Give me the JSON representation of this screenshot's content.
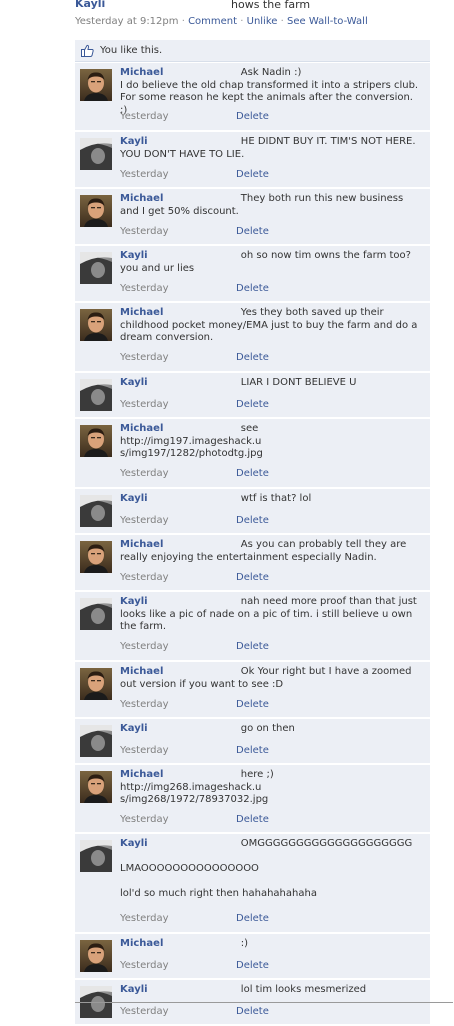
{
  "post": {
    "author": "Kayli",
    "text": "hows the farm",
    "timestamp": "Yesterday at 9:12pm",
    "comment_link": "Comment",
    "unlike_link": "Unlike",
    "wall_link": "See Wall-to-Wall"
  },
  "likes": {
    "text": "You like this.",
    "icon": "thumbs-up-icon"
  },
  "comments": [
    {
      "author": "Michael",
      "text": "Ask Nadin :)\nI do believe the old chap transformed it into a stripers club. For some reason he kept the animals after the conversion. ;)",
      "time": "Yesterday",
      "delete": "Delete"
    },
    {
      "author": "Kayli",
      "text": "HE DIDNT BUY IT. TIM'S NOT HERE. YOU DON'T HAVE TO LIE.",
      "time": "Yesterday",
      "delete": "Delete"
    },
    {
      "author": "Michael",
      "text": "They both run this new business and I get 50% discount.",
      "time": "Yesterday",
      "delete": "Delete"
    },
    {
      "author": "Kayli",
      "text": "oh so now tim owns the farm too? you and ur lies",
      "time": "Yesterday",
      "delete": "Delete"
    },
    {
      "author": "Michael",
      "text": "Yes they both saved up their childhood pocket money/EMA just to buy the farm and do a dream conversion.",
      "time": "Yesterday",
      "delete": "Delete"
    },
    {
      "author": "Kayli",
      "text": "LIAR I DONT BELIEVE U",
      "time": "Yesterday",
      "delete": "Delete"
    },
    {
      "author": "Michael",
      "text": "see\nhttp://img197.imageshack.u\ns/img197/1282/photodtg.jpg",
      "time": "Yesterday",
      "delete": "Delete"
    },
    {
      "author": "Kayli",
      "text": "wtf is that? lol",
      "time": "Yesterday",
      "delete": "Delete"
    },
    {
      "author": "Michael",
      "text": "As you can probably tell they are really enjoying the entertainment especially Nadin.",
      "time": "Yesterday",
      "delete": "Delete"
    },
    {
      "author": "Kayli",
      "text": "nah need more proof than that just looks like a pic of nade on a pic of tim. i still believe u own the farm.",
      "time": "Yesterday",
      "delete": "Delete"
    },
    {
      "author": "Michael",
      "text": "Ok Your right but I have a zoomed out version if you want to see :D",
      "time": "Yesterday",
      "delete": "Delete"
    },
    {
      "author": "Kayli",
      "text": "go on then",
      "time": "Yesterday",
      "delete": "Delete"
    },
    {
      "author": "Michael",
      "text": "here ;)\nhttp://img268.imageshack.u\ns/img268/1972/78937032.jpg",
      "time": "Yesterday",
      "delete": "Delete"
    },
    {
      "author": "Kayli",
      "text": "OMGGGGGGGGGGGGGGGGGGGG\n\nLMAOOOOOOOOOOOOOOO\n\nlol'd so much right then hahahahahaha",
      "time": "Yesterday",
      "delete": "Delete"
    },
    {
      "author": "Michael",
      "text": ":)",
      "time": "Yesterday",
      "delete": "Delete"
    },
    {
      "author": "Kayli",
      "text": "lol tim looks mesmerized",
      "time": "Yesterday",
      "delete": "Delete"
    }
  ]
}
